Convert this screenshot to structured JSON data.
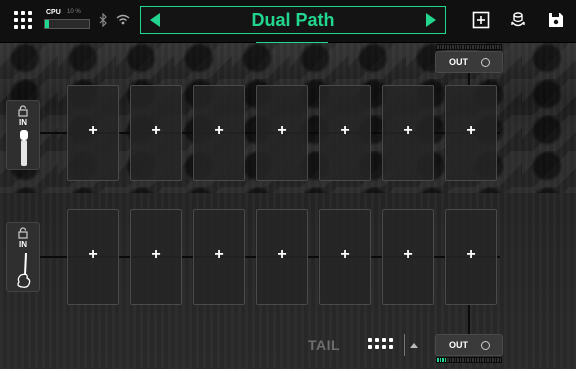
{
  "topbar": {
    "menu_icon": "grid-icon",
    "cpu_label": "CPU",
    "cpu_percent": "10 %",
    "cpu_load": 0.1,
    "bluetooth_icon": "bluetooth-icon",
    "wifi_icon": "wifi-icon",
    "preset_name": "Dual Path",
    "prev_icon": "chevron-left-icon",
    "next_icon": "chevron-right-icon",
    "add_icon": "add-box-icon",
    "tuner_icon": "tuner-icon",
    "save_icon": "save-icon"
  },
  "paths": [
    {
      "input_label": "IN",
      "input_icon": "microphone-icon",
      "slots": [
        "+",
        "+",
        "+",
        "+",
        "+",
        "+",
        "+"
      ]
    },
    {
      "input_label": "IN",
      "input_icon": "guitar-icon",
      "slots": [
        "+",
        "+",
        "+",
        "+",
        "+",
        "+",
        "+"
      ]
    }
  ],
  "outputs": [
    {
      "label": "OUT",
      "meter_level": 0.0
    },
    {
      "label": "OUT",
      "meter_level": 0.12
    }
  ],
  "footer": {
    "tail_label": "TAIL",
    "grid_icon": "grid-icon",
    "expand_icon": "chevron-up-icon"
  },
  "colors": {
    "accent": "#22d68f",
    "background": "#1a1a1a",
    "slot": "#262626"
  }
}
